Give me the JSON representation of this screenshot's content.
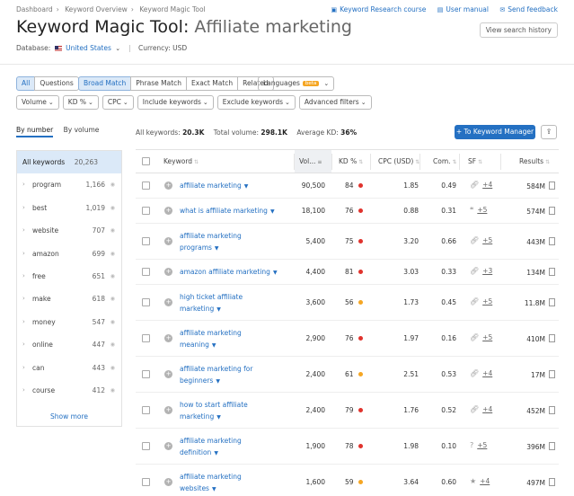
{
  "breadcrumbs": [
    "Dashboard",
    "Keyword Overview",
    "Keyword Magic Tool"
  ],
  "top_links": [
    {
      "icon": "book-icon",
      "label": "Keyword Research course"
    },
    {
      "icon": "doc-icon",
      "label": "User manual"
    },
    {
      "icon": "mail-icon",
      "label": "Send feedback"
    }
  ],
  "title": {
    "prefix": "Keyword Magic Tool:",
    "keyword": "Affiliate marketing"
  },
  "history_button": "View search history",
  "database": {
    "label": "Database:",
    "value": "United States",
    "currency": "Currency: USD"
  },
  "match_tabs": [
    "All",
    "Questions",
    "Broad Match",
    "Phrase Match",
    "Exact Match",
    "Related"
  ],
  "languages": {
    "label": "Languages",
    "badge": "beta"
  },
  "filters": [
    "Volume",
    "KD %",
    "CPC",
    "Include keywords",
    "Exclude keywords",
    "Advanced filters"
  ],
  "sidebar": {
    "tabs": [
      "By number",
      "By volume"
    ],
    "all": {
      "label": "All keywords",
      "count": "20,263"
    },
    "groups": [
      {
        "label": "program",
        "count": "1,166"
      },
      {
        "label": "best",
        "count": "1,019"
      },
      {
        "label": "website",
        "count": "707"
      },
      {
        "label": "amazon",
        "count": "699"
      },
      {
        "label": "free",
        "count": "651"
      },
      {
        "label": "make",
        "count": "618"
      },
      {
        "label": "money",
        "count": "547"
      },
      {
        "label": "online",
        "count": "447"
      },
      {
        "label": "can",
        "count": "443"
      },
      {
        "label": "course",
        "count": "412"
      }
    ],
    "show_more": "Show more"
  },
  "stats": {
    "all_label": "All keywords:",
    "all_value": "20.3K",
    "vol_label": "Total volume:",
    "vol_value": "298.1K",
    "kd_label": "Average KD:",
    "kd_value": "36%"
  },
  "to_keyword_manager": "To Keyword Manager",
  "table": {
    "headers": [
      "Keyword",
      "Vol...",
      "KD %",
      "CPC (USD)",
      "Com.",
      "SF",
      "Results"
    ],
    "rows": [
      {
        "kw1": "affiliate marketing",
        "kw2": "",
        "vol": "90,500",
        "kd": "84",
        "kd_color": "#e0332d",
        "cpc": "1.85",
        "com": "0.49",
        "sf_icon": "link-icon",
        "sf": "+4",
        "results": "584M"
      },
      {
        "kw1": "what is affiliate marketing",
        "kw2": "",
        "vol": "18,100",
        "kd": "76",
        "kd_color": "#e0332d",
        "cpc": "0.88",
        "com": "0.31",
        "sf_icon": "quote-icon",
        "sf": "+5",
        "results": "574M"
      },
      {
        "kw1": "affiliate marketing",
        "kw2": "programs",
        "vol": "5,400",
        "kd": "75",
        "kd_color": "#e0332d",
        "cpc": "3.20",
        "com": "0.66",
        "sf_icon": "link-icon",
        "sf": "+5",
        "results": "443M"
      },
      {
        "kw1": "amazon affiliate marketing",
        "kw2": "",
        "vol": "4,400",
        "kd": "81",
        "kd_color": "#e0332d",
        "cpc": "3.03",
        "com": "0.33",
        "sf_icon": "link-icon",
        "sf": "+3",
        "results": "134M"
      },
      {
        "kw1": "high ticket affiliate",
        "kw2": "marketing",
        "vol": "3,600",
        "kd": "56",
        "kd_color": "#f5a623",
        "cpc": "1.73",
        "com": "0.45",
        "sf_icon": "link-icon",
        "sf": "+5",
        "results": "11.8M"
      },
      {
        "kw1": "affiliate marketing",
        "kw2": "meaning",
        "vol": "2,900",
        "kd": "76",
        "kd_color": "#e0332d",
        "cpc": "1.97",
        "com": "0.16",
        "sf_icon": "link-icon",
        "sf": "+5",
        "results": "410M"
      },
      {
        "kw1": "affiliate marketing for",
        "kw2": "beginners",
        "vol": "2,400",
        "kd": "61",
        "kd_color": "#f5a623",
        "cpc": "2.51",
        "com": "0.53",
        "sf_icon": "link-icon",
        "sf": "+4",
        "results": "17M"
      },
      {
        "kw1": "how to start affiliate",
        "kw2": "marketing",
        "vol": "2,400",
        "kd": "79",
        "kd_color": "#e0332d",
        "cpc": "1.76",
        "com": "0.52",
        "sf_icon": "link-icon",
        "sf": "+4",
        "results": "452M"
      },
      {
        "kw1": "affiliate marketing",
        "kw2": "definition",
        "vol": "1,900",
        "kd": "78",
        "kd_color": "#e0332d",
        "cpc": "1.98",
        "com": "0.10",
        "sf_icon": "question-icon",
        "sf": "+5",
        "results": "396M"
      },
      {
        "kw1": "affiliate marketing",
        "kw2": "websites",
        "vol": "1,600",
        "kd": "59",
        "kd_color": "#f5a623",
        "cpc": "3.64",
        "com": "0.60",
        "sf_icon": "star-icon",
        "sf": "+4",
        "results": "497M"
      }
    ]
  }
}
